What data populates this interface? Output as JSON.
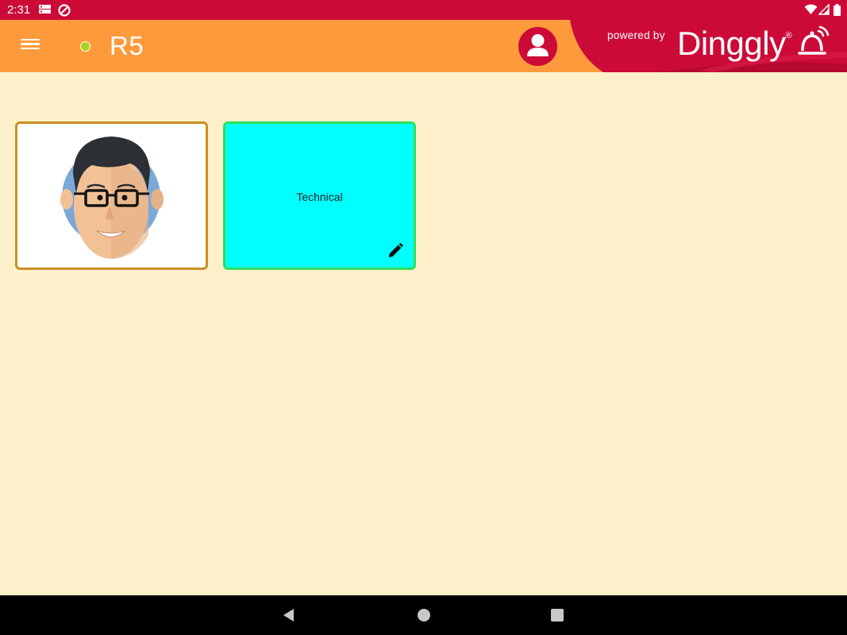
{
  "status_bar": {
    "time": "2:31",
    "icons": [
      "server-icon",
      "no-disturb-icon",
      "wifi-icon",
      "signal-icon",
      "battery-icon"
    ]
  },
  "app_bar": {
    "room_name": "R5",
    "status_dot_color": "#a9d11d",
    "powered_by": "powered by",
    "brand": "Dinggly",
    "brand_mark": "®",
    "accent_color": "#ff9a3c",
    "brand_color": "#cc0a38"
  },
  "cards": [
    {
      "kind": "avatar",
      "name": "person-avatar-card",
      "border_color": "#c8901f"
    },
    {
      "kind": "category",
      "label": "Technical",
      "bg_color": "#00ffff",
      "border_color": "#2ee05b"
    }
  ],
  "nav_bar": {
    "buttons": [
      "back-icon",
      "home-icon",
      "recents-icon"
    ]
  }
}
